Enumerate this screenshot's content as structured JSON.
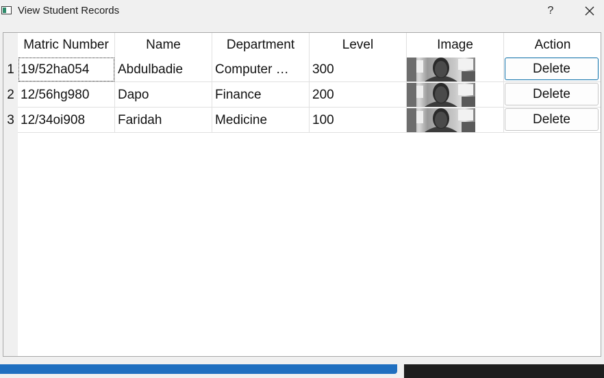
{
  "window": {
    "title": "View Student Records",
    "help_label": "?"
  },
  "table": {
    "columns": [
      "Matric Number",
      "Name",
      "Department",
      "Level",
      "Image",
      "Action"
    ],
    "rows": [
      {
        "num": "1",
        "matric": "19/52ha054",
        "name": "Abdulbadie",
        "department": "Computer …",
        "level": "300",
        "action": "Delete"
      },
      {
        "num": "2",
        "matric": "12/56hg980",
        "name": "Dapo",
        "department": "Finance",
        "level": "200",
        "action": "Delete"
      },
      {
        "num": "3",
        "matric": "12/34oi908",
        "name": "Faridah",
        "department": "Medicine",
        "level": "100",
        "action": "Delete"
      }
    ]
  },
  "icons": {
    "app": "app-window-icon",
    "close": "close-icon",
    "thumbnail": "student-photo-thumbnail"
  }
}
